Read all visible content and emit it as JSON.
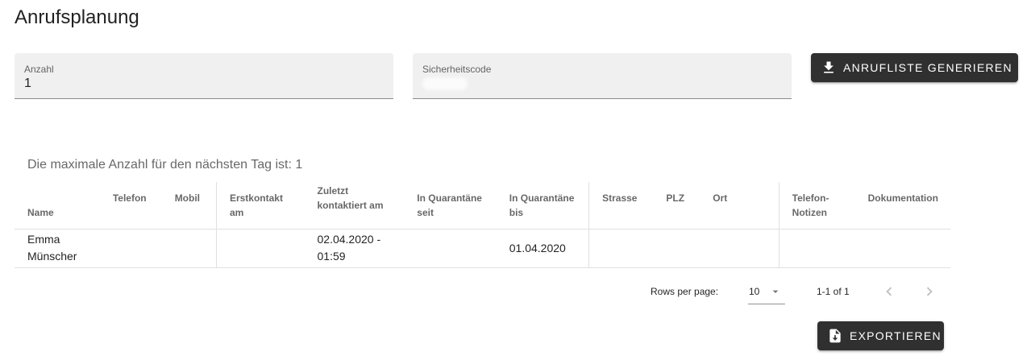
{
  "page": {
    "title": "Anrufsplanung"
  },
  "form": {
    "count_label": "Anzahl",
    "count_value": "1",
    "code_label": "Sicherheitscode",
    "generate_label": "ANRUFLISTE GENERIEREN",
    "generate_icon": "download-icon"
  },
  "info": {
    "text": "Die maximale Anzahl für den nächsten Tag ist: 1"
  },
  "table": {
    "headers": {
      "name": "Name",
      "telefon": "Telefon",
      "mobil": "Mobil",
      "erstkontakt_line1": "Erstkontakt",
      "erstkontakt_line2": "am",
      "zuletzt_line1": "Zuletzt",
      "zuletzt_line2": "kontaktiert am",
      "quarantaene_seit_line1": "In Quarantäne",
      "quarantaene_seit_line2": "seit",
      "quarantaene_bis_line1": "In Quarantäne",
      "quarantaene_bis_line2": "bis",
      "strasse": "Strasse",
      "plz": "PLZ",
      "ort": "Ort",
      "notizen_line1": "Telefon-",
      "notizen_line2": "Notizen",
      "dokumentation": "Dokumentation"
    },
    "rows": [
      {
        "name_line1": "Emma",
        "name_line2": "Münscher",
        "telefon": "",
        "mobil": "",
        "erstkontakt": "",
        "zuletzt_line1": "02.04.2020 -",
        "zuletzt_line2": "01:59",
        "quarantaene_seit": "",
        "quarantaene_bis": "01.04.2020",
        "strasse": "",
        "plz": "",
        "ort": "",
        "notizen": "",
        "dokumentation": ""
      }
    ]
  },
  "pagination": {
    "rows_per_page_label": "Rows per page:",
    "rows_per_page_value": "10",
    "range": "1-1 of 1"
  },
  "export": {
    "label": "EXPORTIEREN",
    "icon": "file-download-icon"
  },
  "colors": {
    "button_bg": "#303030",
    "field_bg": "#f0f0f0"
  }
}
